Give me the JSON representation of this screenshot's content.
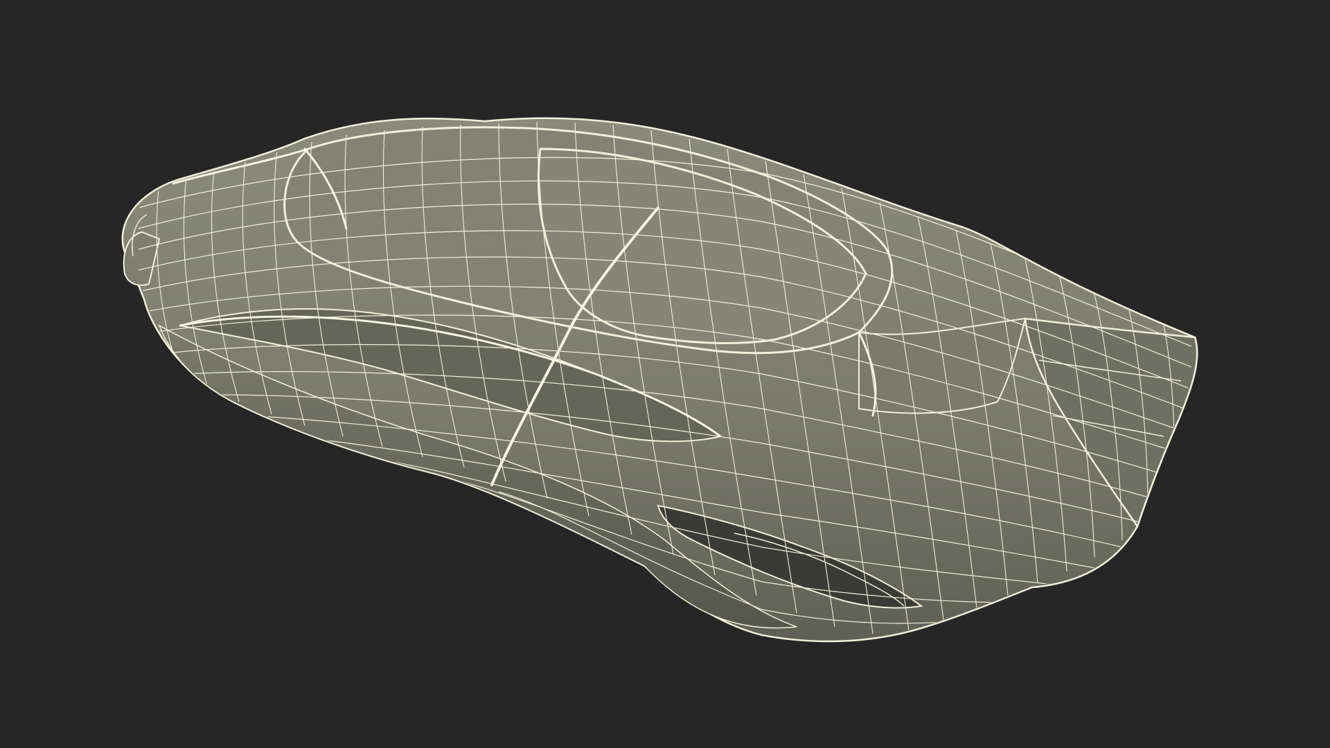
{
  "scene": {
    "subject": "wireframe-car-model",
    "colors": {
      "background": "#262626",
      "surface": "#7f8072",
      "surface_shadow": "#5e5f53",
      "surface_highlight": "#8e8f80",
      "wire": "#f2f0dc",
      "cavity": "#3a3b34"
    },
    "icons": []
  }
}
